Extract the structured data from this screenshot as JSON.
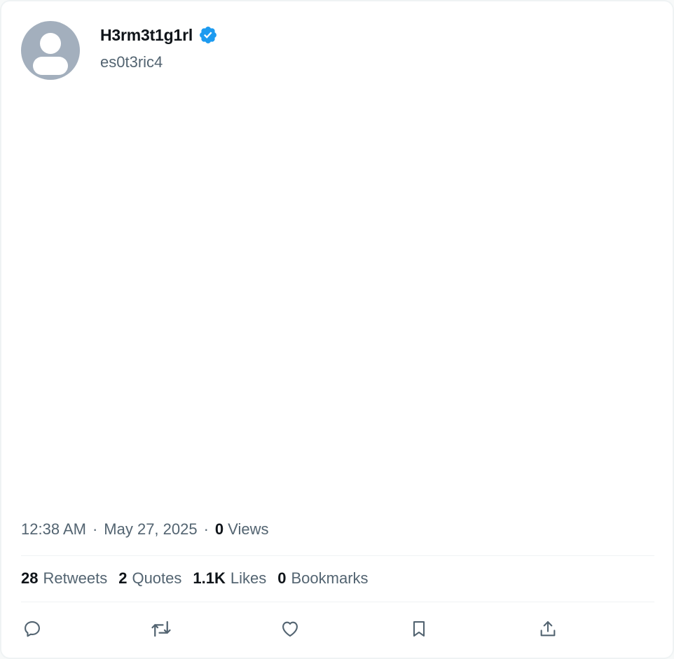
{
  "user": {
    "display_name": "H3rm3t1g1rl",
    "handle": "es0t3ric4",
    "verified": true
  },
  "meta": {
    "time": "12:38 AM",
    "separator": "·",
    "date": "May 27, 2025",
    "views_count": "0",
    "views_label": "Views"
  },
  "stats": {
    "retweets_count": "28",
    "retweets_label": "Retweets",
    "quotes_count": "2",
    "quotes_label": "Quotes",
    "likes_count": "1.1K",
    "likes_label": "Likes",
    "bookmarks_count": "0",
    "bookmarks_label": "Bookmarks"
  },
  "actions": [
    "reply-icon",
    "retweet-icon",
    "like-icon",
    "bookmark-icon",
    "share-icon"
  ],
  "colors": {
    "text_primary": "#0f1419",
    "text_secondary": "#536471",
    "verified_blue": "#1d9bf0",
    "avatar_bg": "#a3afbd",
    "divider": "#eff3f4"
  }
}
